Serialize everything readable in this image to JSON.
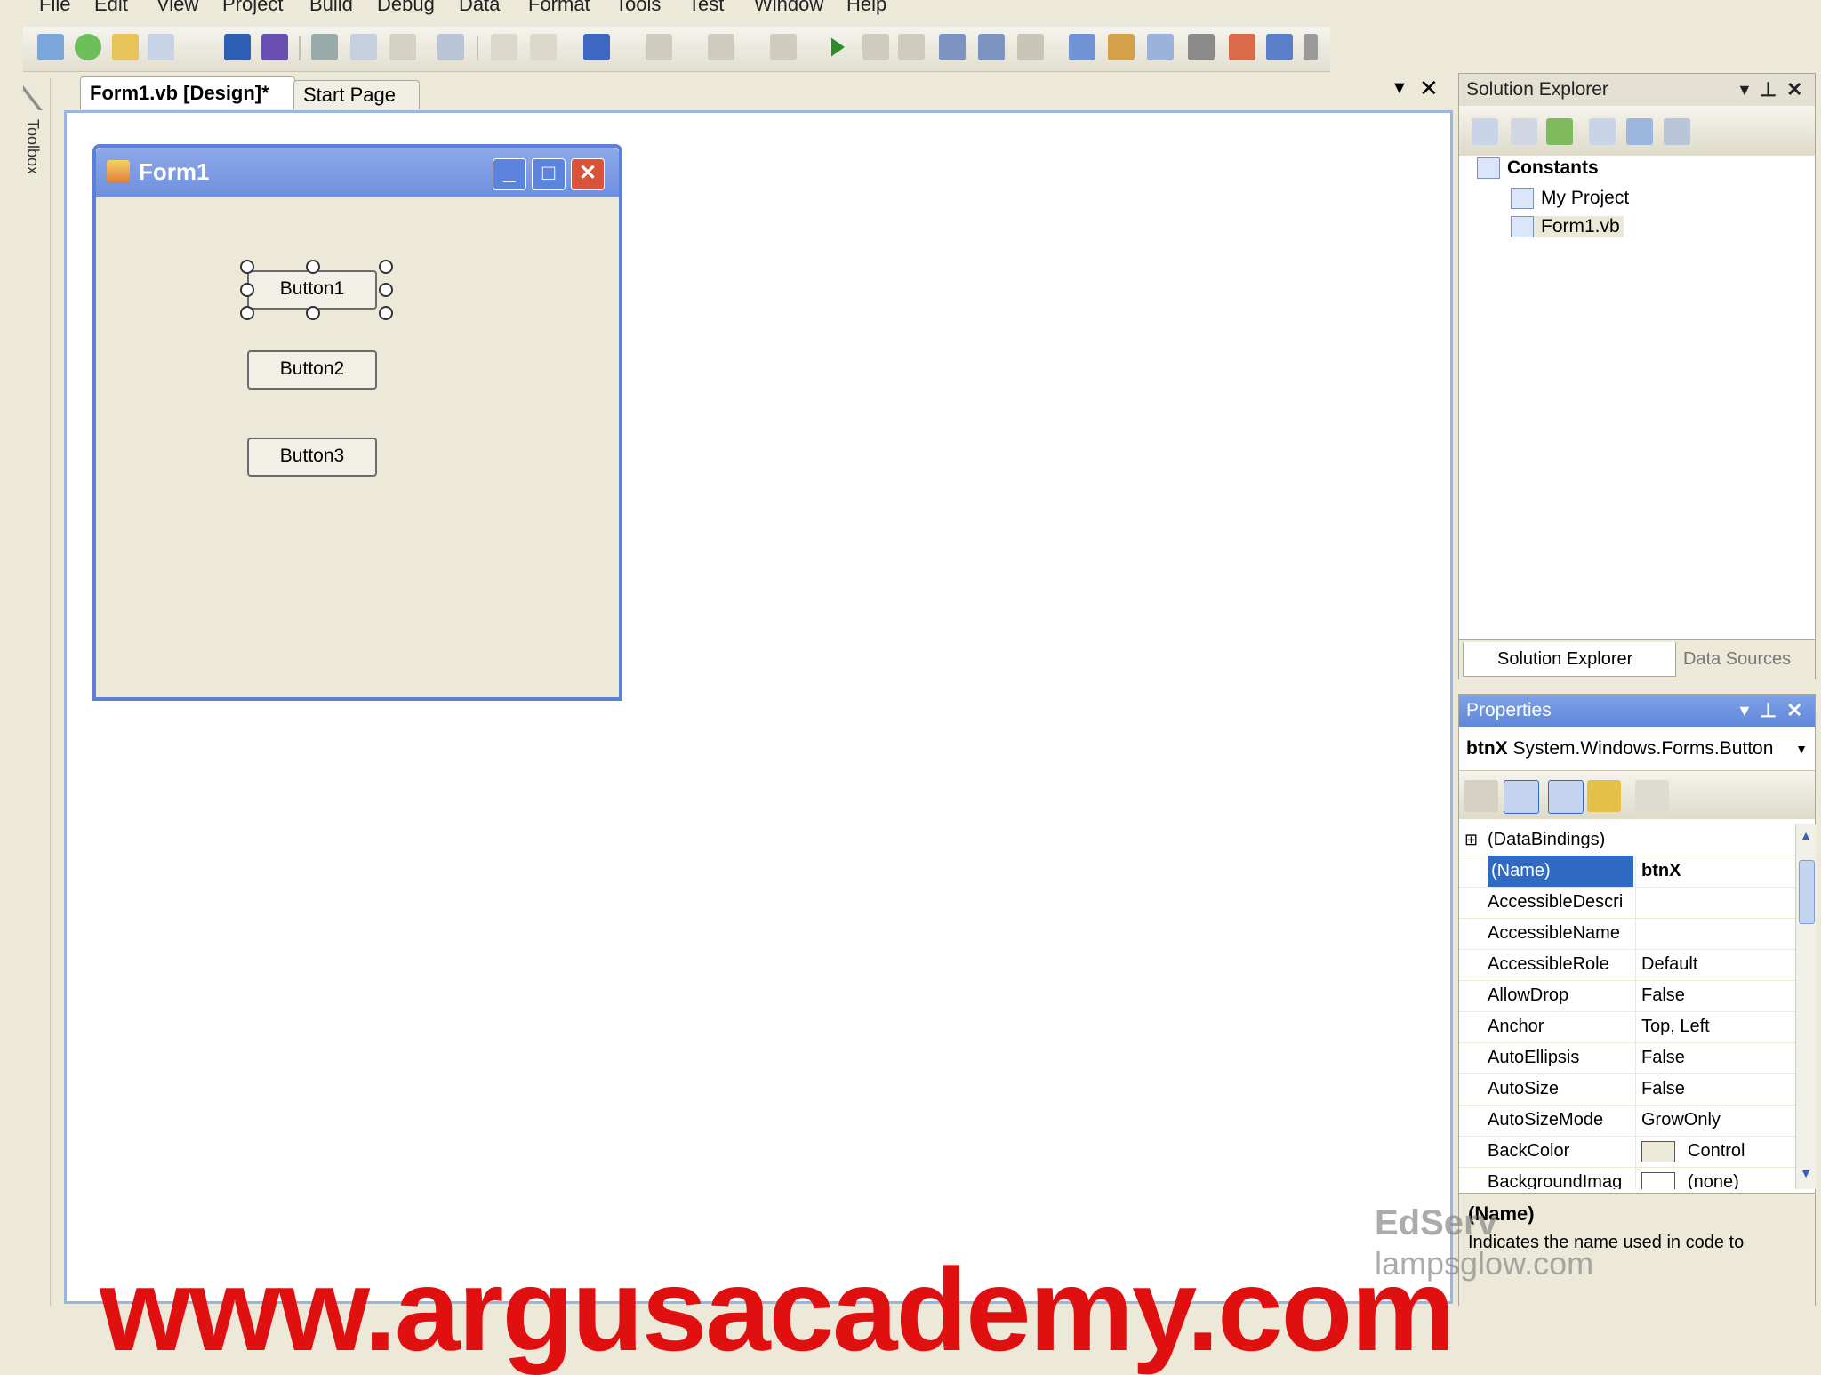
{
  "menu": [
    "File",
    "Edit",
    "View",
    "Project",
    "Build",
    "Debug",
    "Data",
    "Format",
    "Tools",
    "Test",
    "Window",
    "Help"
  ],
  "toolbox": {
    "label": "Toolbox"
  },
  "doc_tabs": {
    "design": "Form1.vb [Design]*",
    "start": "Start Page"
  },
  "form": {
    "title": "Form1",
    "buttons": [
      "Button1",
      "Button2",
      "Button3"
    ]
  },
  "solution_explorer": {
    "title": "Solution Explorer",
    "tree": {
      "root": "Constants",
      "children": [
        "My Project",
        "Form1.vb"
      ]
    },
    "tabs": [
      "Solution Explorer",
      "Data Sources"
    ]
  },
  "properties": {
    "title": "Properties",
    "object": {
      "name": "btnX",
      "type": "System.Windows.Forms.Button"
    },
    "rows": [
      {
        "name": "(DataBindings)",
        "value": ""
      },
      {
        "name": "(Name)",
        "value": "btnX"
      },
      {
        "name": "AccessibleDescri",
        "value": ""
      },
      {
        "name": "AccessibleName",
        "value": ""
      },
      {
        "name": "AccessibleRole",
        "value": "Default"
      },
      {
        "name": "AllowDrop",
        "value": "False"
      },
      {
        "name": "Anchor",
        "value": "Top, Left"
      },
      {
        "name": "AutoEllipsis",
        "value": "False"
      },
      {
        "name": "AutoSize",
        "value": "False"
      },
      {
        "name": "AutoSizeMode",
        "value": "GrowOnly"
      },
      {
        "name": "BackColor",
        "value": "Control"
      },
      {
        "name": "BackgroundImag",
        "value": "(none)"
      }
    ],
    "description": {
      "title": "(Name)",
      "text": "Indicates the name used in code to"
    }
  },
  "watermark": {
    "text": "www.argusacademy.com",
    "logo_top": "EdServ",
    "logo_bottom": "lampsglow.com"
  },
  "colors": {
    "accent": "#316ac5",
    "watermark": "#e01010",
    "form_border": "#5a80d8"
  }
}
